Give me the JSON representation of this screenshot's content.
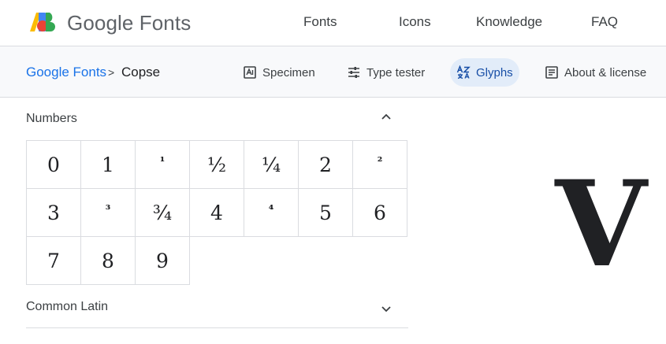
{
  "header": {
    "brand": "Google Fonts",
    "nav": [
      "Fonts",
      "Icons",
      "Knowledge",
      "FAQ"
    ]
  },
  "breadcrumb": {
    "root": "Google Fonts",
    "separator": ">",
    "current": "Copse"
  },
  "tabs": [
    {
      "label": "Specimen",
      "icon": "specimen-icon",
      "active": false
    },
    {
      "label": "Type tester",
      "icon": "tune-icon",
      "active": false
    },
    {
      "label": "Glyphs",
      "icon": "glyphs-icon",
      "active": true
    },
    {
      "label": "About & license",
      "icon": "article-icon",
      "active": false
    }
  ],
  "sections": {
    "numbers": {
      "title": "Numbers",
      "expanded": true,
      "glyphs": [
        "0",
        "1",
        "¹",
        "½",
        "¼",
        "2",
        "²",
        "3",
        "³",
        "¾",
        "4",
        "⁴",
        "5",
        "6",
        "7",
        "8",
        "9"
      ]
    },
    "common_latin": {
      "title": "Common Latin",
      "expanded": false
    }
  },
  "preview": {
    "glyph": "V"
  },
  "colors": {
    "accent": "#1a73e8",
    "active_tab_bg": "#e2ecf9",
    "border": "#dadce0",
    "logo_yellow": "#fbbc04",
    "logo_blue": "#4285f4",
    "logo_red": "#ea4335",
    "logo_green": "#34a853"
  }
}
